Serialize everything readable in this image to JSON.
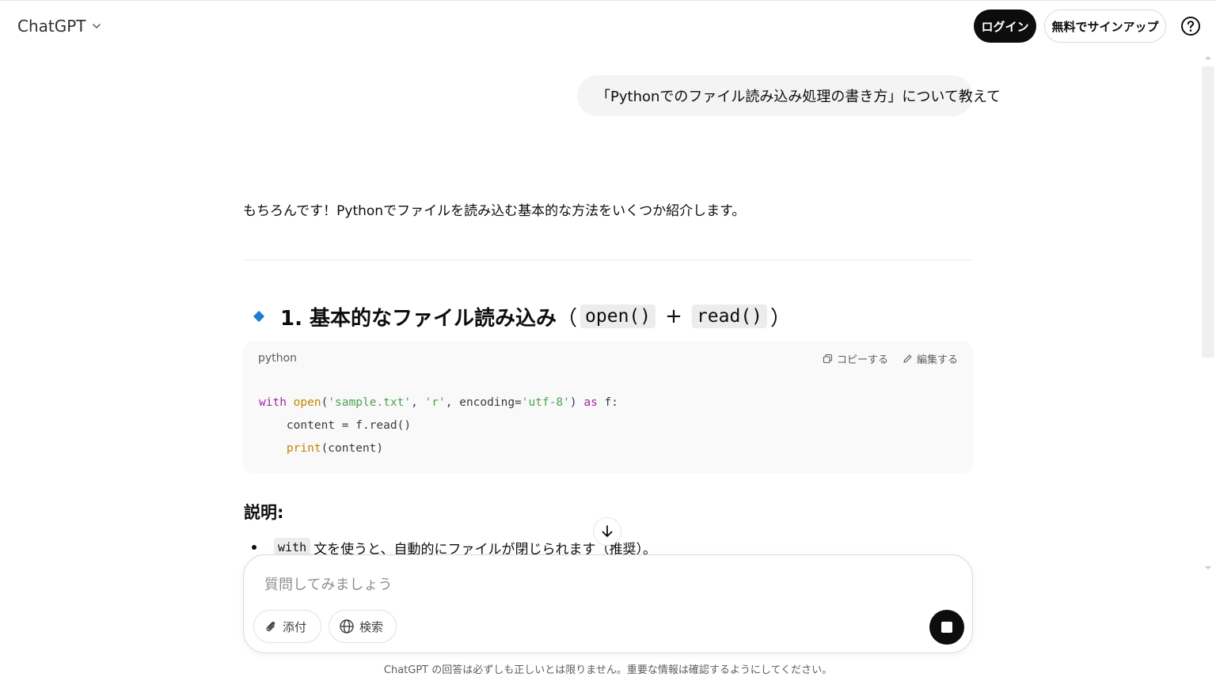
{
  "header": {
    "title": "ChatGPT",
    "login_label": "ログイン",
    "signup_label": "無料でサインアップ",
    "help_icon": "question-circle-icon"
  },
  "conversation": {
    "user_message": "「Pythonでのファイル読み込み処理の書き方」について教えて",
    "assistant": {
      "intro": "もちろんです！Pythonでファイルを読み込む基本的な方法をいくつか紹介します。",
      "heading": {
        "number_text": "1. 基本的なファイル読み込み",
        "open_paren": "（",
        "code1": "open()",
        "plus": "+",
        "code2": "read()",
        "close_paren": "）"
      },
      "code_block": {
        "language": "python",
        "copy_label": "コピーする",
        "edit_label": "編集する",
        "lines": [
          "with open('sample.txt', 'r', encoding='utf-8') as f:",
          "    content = f.read()",
          "    print(content)"
        ]
      },
      "explanation_title": "説明:",
      "bullet": {
        "code": "with",
        "text": "文を使うと、自動的にファイルが閉じられます（推奨）。"
      }
    }
  },
  "composer": {
    "placeholder": "質問してみましょう",
    "attach_label": "添付",
    "search_label": "検索"
  },
  "footer": {
    "disclaimer": "ChatGPT の回答は必ずしも正しいとは限りません。重要な情報は確認するようにしてください。"
  },
  "colors": {
    "accent_diamond": "#1d7bd4",
    "primary_button": "#0d0d0d",
    "keyword": "#a626a4",
    "function": "#c18401",
    "string": "#50a14f"
  }
}
